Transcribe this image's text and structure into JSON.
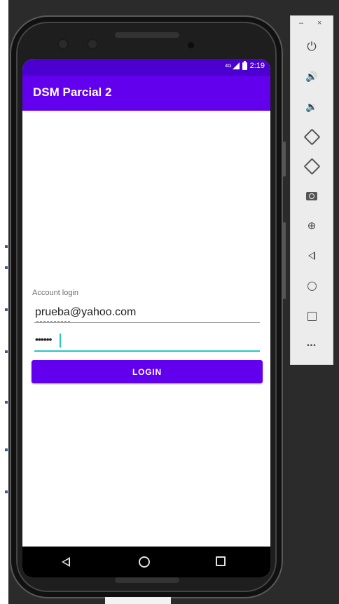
{
  "status_bar": {
    "time": "2:19",
    "network": "4G"
  },
  "app_bar": {
    "title": "DSM Parcial 2"
  },
  "login_form": {
    "label": "Account login",
    "email_value": "prueba@yahoo.com",
    "password_value": "••••••",
    "login_button_label": "LOGIN"
  },
  "emulator_toolbar": {
    "minimize": "–",
    "close": "×",
    "power_icon": "⏻",
    "volume_up_icon": "🔊",
    "volume_down_icon": "🔉",
    "zoom_icon": "⊕",
    "more_icon": "•••"
  },
  "colors": {
    "primary": "#6200ee",
    "status_bar": "#4c00cf",
    "accent": "#26c6c6",
    "nav_bar": "#000000"
  }
}
